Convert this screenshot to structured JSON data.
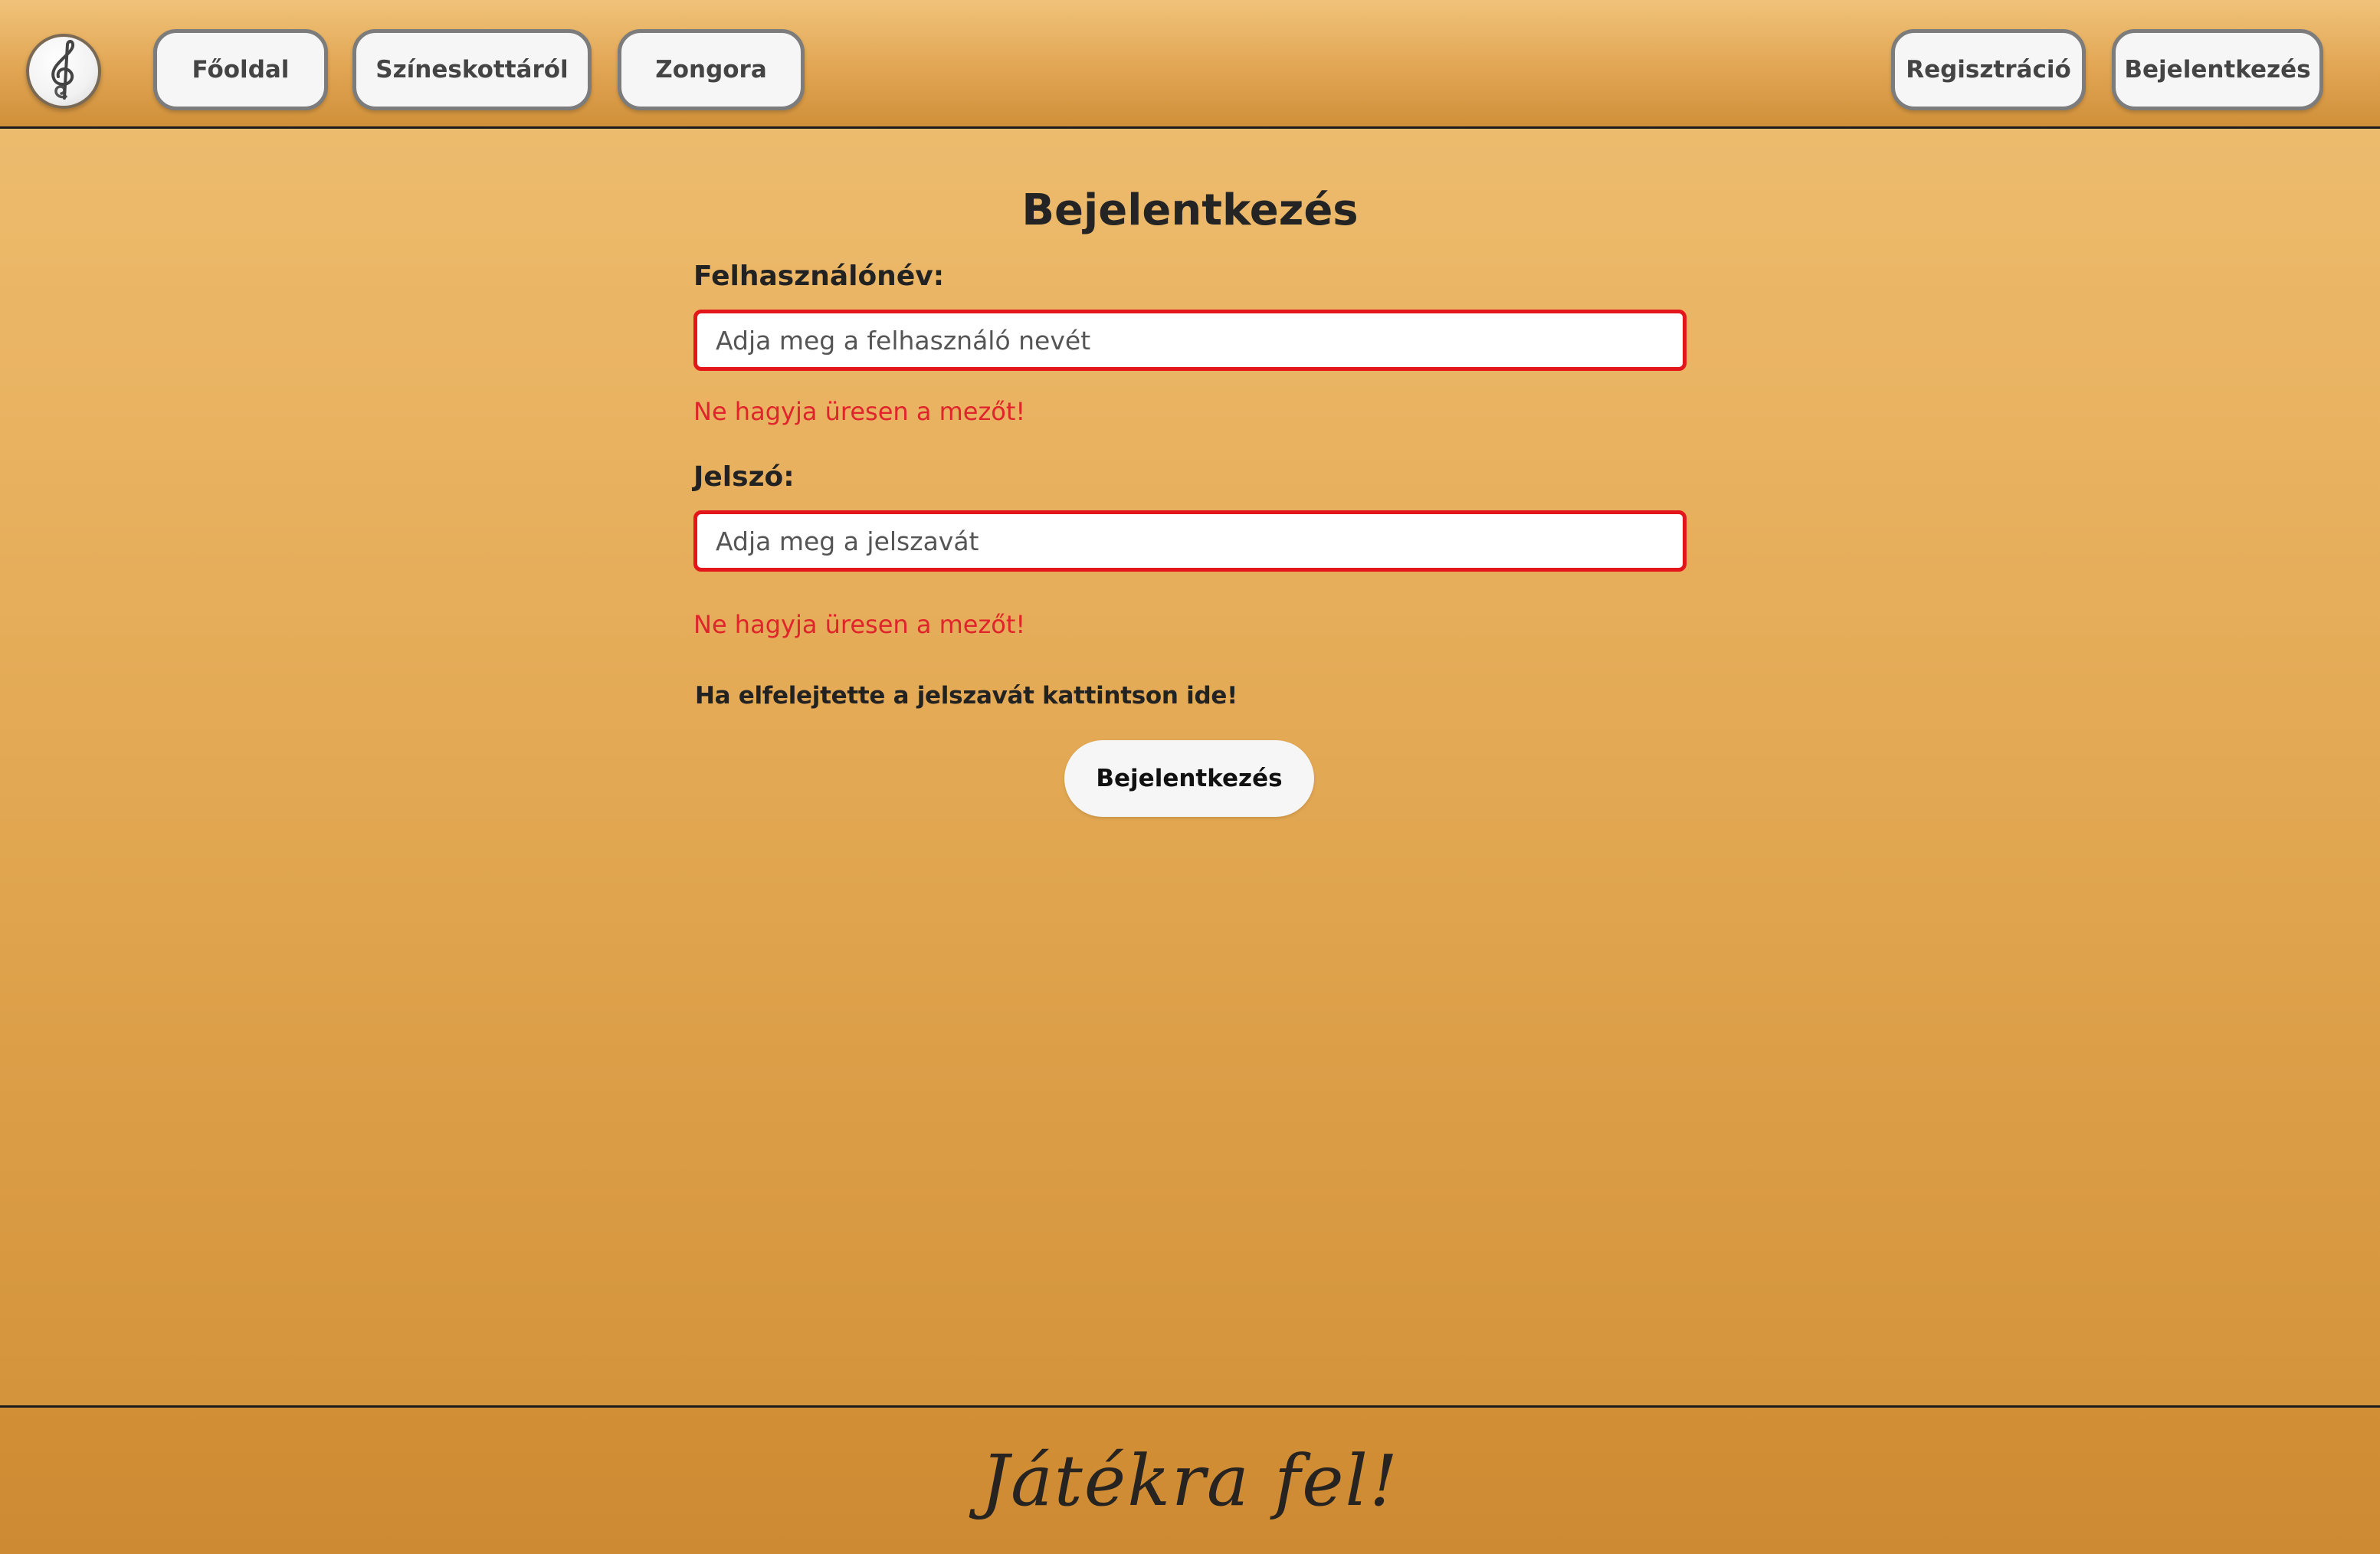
{
  "header": {
    "logo_icon": "treble-clef-icon",
    "nav_left": [
      {
        "label": "Főoldal"
      },
      {
        "label": "Színeskottáról"
      },
      {
        "label": "Zongora"
      }
    ],
    "nav_right": [
      {
        "label": "Regisztráció"
      },
      {
        "label": "Bejelentkezés"
      }
    ]
  },
  "login_form": {
    "title": "Bejelentkezés",
    "username": {
      "label": "Felhasználónév:",
      "value": "",
      "placeholder": "Adja meg a felhasználó nevét",
      "error": "Ne hagyja üresen a mezőt!"
    },
    "password": {
      "label": "Jelszó:",
      "value": "",
      "placeholder": "Adja meg a jelszavát",
      "error": "Ne hagyja üresen a mezőt!"
    },
    "forgot_password": "Ha elfelejtette a jelszavát kattintson ide!",
    "submit_label": "Bejelentkezés"
  },
  "footer": {
    "text": "Játékra fel!"
  },
  "colors": {
    "background_top": "#efbf72",
    "background_bottom": "#d08f35",
    "error": "#e0242b",
    "input_border_error": "#e3161c",
    "button_bg": "#f6f6f6"
  }
}
